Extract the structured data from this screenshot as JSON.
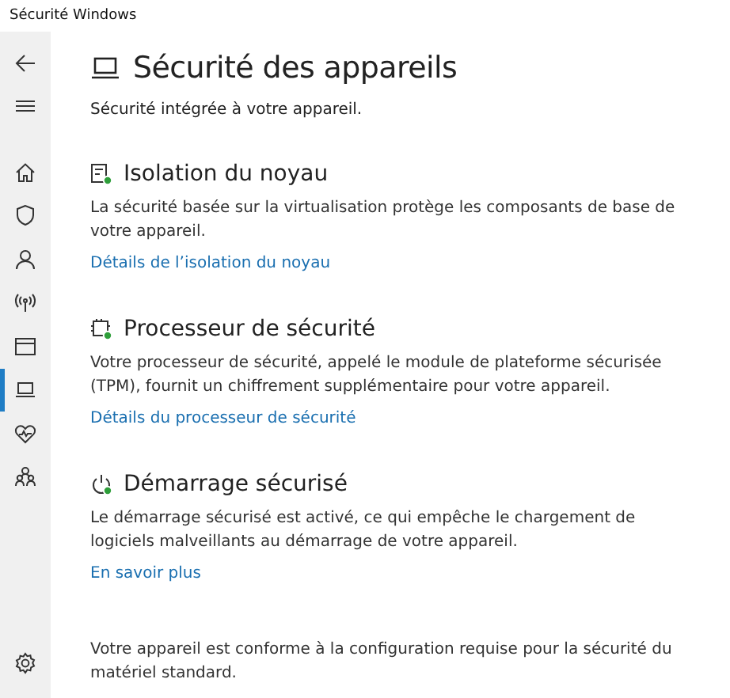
{
  "window": {
    "title": "Sécurité Windows"
  },
  "sidebar": {
    "items": [
      {
        "selected": false
      },
      {
        "selected": false
      },
      {
        "selected": false
      },
      {
        "selected": false
      },
      {
        "selected": false
      },
      {
        "selected": false
      },
      {
        "selected": false
      },
      {
        "selected": true
      },
      {
        "selected": false
      },
      {
        "selected": false
      }
    ]
  },
  "page": {
    "title": "Sécurité des appareils",
    "subtitle": "Sécurité intégrée à votre appareil."
  },
  "sections": [
    {
      "title": "Isolation du noyau",
      "description": "La sécurité basée sur la virtualisation protège les composants de base de votre appareil.",
      "link": "Détails de l’isolation du noyau"
    },
    {
      "title": "Processeur de sécurité",
      "description": "Votre processeur de sécurité, appelé le module de plateforme sécurisée (TPM), fournit un chiffrement supplémentaire pour votre appareil.",
      "link": "Détails du processeur de sécurité"
    },
    {
      "title": "Démarrage sécurisé",
      "description": "Le démarrage sécurisé est activé, ce qui empêche le chargement de logiciels malveillants au démarrage de votre appareil.",
      "link": "En savoir plus"
    }
  ],
  "footer": "Votre appareil est conforme à la configuration requise pour la sécurité du matériel standard."
}
